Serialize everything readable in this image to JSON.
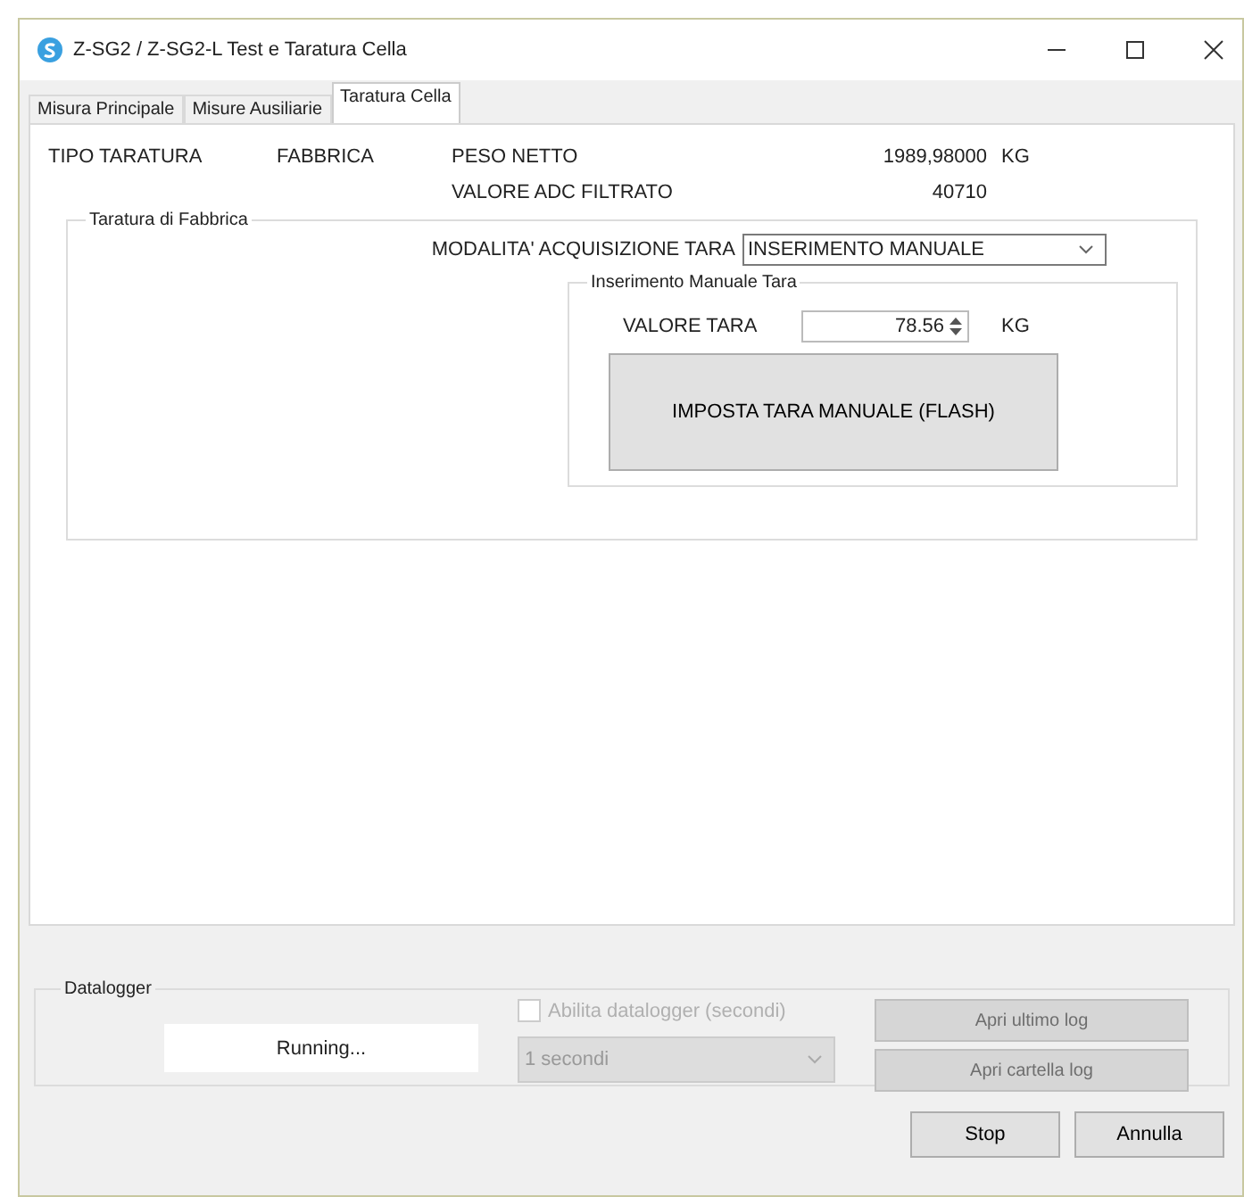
{
  "window": {
    "title": "Z-SG2 / Z-SG2-L Test e Taratura Cella"
  },
  "tabs": [
    {
      "label": "Misura Principale",
      "selected": false
    },
    {
      "label": "Misure Ausiliarie",
      "selected": false
    },
    {
      "label": "Taratura Cella",
      "selected": true
    }
  ],
  "info": {
    "tipo_label": "TIPO TARATURA",
    "tipo_value": "FABBRICA",
    "peso_label": "PESO NETTO",
    "peso_value": "1989,98000",
    "peso_unit": "KG",
    "adc_label": "VALORE ADC FILTRATO",
    "adc_value": "40710"
  },
  "factory_group": {
    "title": "Taratura di Fabbrica",
    "mode_label": "MODALITA' ACQUISIZIONE TARA",
    "mode_value": "INSERIMENTO MANUALE",
    "manual_group": {
      "title": "Inserimento Manuale Tara",
      "tare_label": "VALORE TARA",
      "tare_value": "78.56",
      "tare_unit": "KG",
      "button": "IMPOSTA TARA MANUALE (FLASH)"
    }
  },
  "datalogger": {
    "title": "Datalogger",
    "status": "Running...",
    "enable_label": "Abilita datalogger (secondi)",
    "enable_checked": false,
    "enable_disabled": true,
    "interval": "1 secondi",
    "buttons": [
      {
        "label": "Apri ultimo log",
        "disabled": true
      },
      {
        "label": "Apri cartella log",
        "disabled": true
      }
    ]
  },
  "buttons": [
    {
      "label": "Stop"
    },
    {
      "label": "Annulla"
    }
  ]
}
